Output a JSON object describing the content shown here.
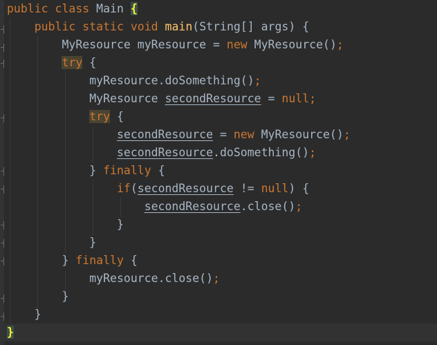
{
  "code": {
    "kw_public": "public",
    "kw_class": "class",
    "class_name": "Main",
    "brace_open": "{",
    "brace_close": "}",
    "kw_static": "static",
    "kw_void": "void",
    "method_main": "main",
    "main_params": "(String[] args) {",
    "type_myresource": "MyResource",
    "var_myresource": "myResource",
    "var_second": "secondResource",
    "op_assign": " = ",
    "kw_new": "new",
    "ctor_call": "MyResource()",
    "semicolon": ";",
    "kw_try": "try",
    "open_brace_sp": " {",
    "call_dosomething": ".doSomething()",
    "call_close": ".close()",
    "kw_null": "null",
    "closing_brace": "}",
    "kw_finally": "finally",
    "kw_if": "if",
    "paren_open": "(",
    "op_neq": " != ",
    "paren_close_brace": ") {"
  }
}
